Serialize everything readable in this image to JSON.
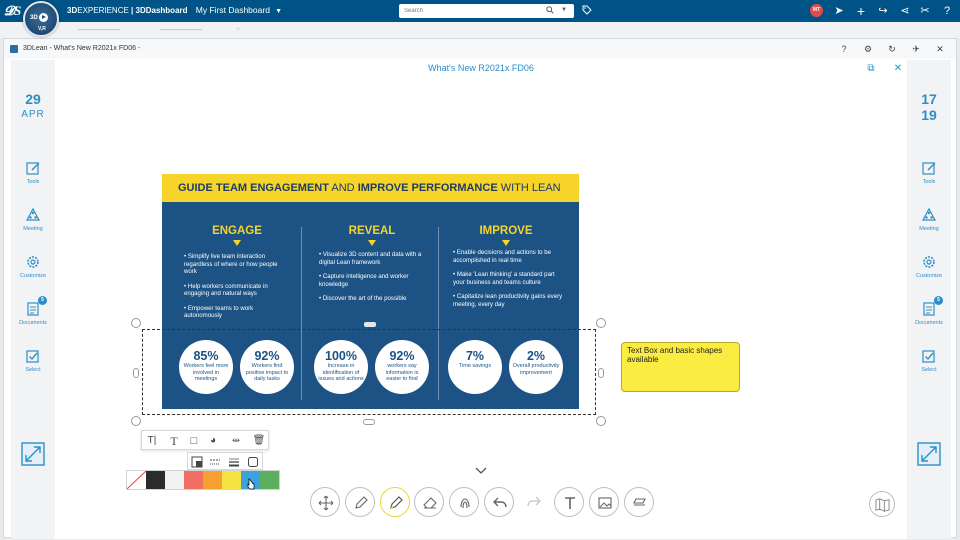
{
  "topbar": {
    "brand_3d": "3D",
    "brand_experience": "EXPERIENCE",
    "app_name": "| 3DDashboard",
    "dashboard_name": "My First Dashboard",
    "compass_3d": "3D",
    "compass_vr": "V,R",
    "search_placeholder": "Search",
    "user_initials": "MT",
    "icons": [
      "share-link-icon",
      "add-icon",
      "forward-icon",
      "share-icon",
      "settings-tools-icon",
      "help-icon"
    ]
  },
  "widget": {
    "title": "3DLean - What's New R2021x FD06 -",
    "header_buttons": [
      "help-icon",
      "settings-icon",
      "refresh-icon",
      "pin-icon",
      "close-icon"
    ],
    "doc_title": "What's New R2021x FD06"
  },
  "left_panel": {
    "date_day": "29",
    "date_month": "APR",
    "items": [
      {
        "label": "Tools",
        "icon": "tools-icon"
      },
      {
        "label": "Meeting",
        "icon": "meeting-icon"
      },
      {
        "label": "Customize",
        "icon": "customize-gear-icon"
      },
      {
        "label": "Documents",
        "icon": "documents-icon",
        "badge": "5"
      },
      {
        "label": "Select",
        "icon": "select-icon"
      }
    ]
  },
  "right_panel": {
    "date_top": "17",
    "date_bottom": "19",
    "items": [
      {
        "label": "Tools",
        "icon": "tools-icon"
      },
      {
        "label": "Meeting",
        "icon": "meeting-icon"
      },
      {
        "label": "Customize",
        "icon": "customize-gear-icon"
      },
      {
        "label": "Documents",
        "icon": "documents-icon",
        "badge": "5"
      },
      {
        "label": "Select",
        "icon": "select-icon"
      }
    ]
  },
  "slide": {
    "banner_part1": "GUIDE TEAM ENGAGEMENT",
    "banner_part2": "AND",
    "banner_part3": "IMPROVE PERFORMANCE",
    "banner_part4": "WITH LEAN",
    "columns": [
      {
        "heading": "ENGAGE",
        "bullets": [
          "• Simplify live team interaction regardless of where or how people work",
          "• Help workers communicate in engaging and natural ways",
          "• Empower teams to work autonomously"
        ],
        "stats": [
          {
            "value": "85%",
            "label": "Workers feel more involved in meetings"
          },
          {
            "value": "92%",
            "label": "Workers find positive impact to daily tasks"
          }
        ]
      },
      {
        "heading": "REVEAL",
        "bullets": [
          "• Visualize 3D content and data with a digital Lean framework",
          "• Capture intelligence and worker knowledge",
          "• Discover the art of the possible"
        ],
        "stats": [
          {
            "value": "100%",
            "label": "Increase in identification of issues and actions"
          },
          {
            "value": "92%",
            "label": "workers say information is easier to find"
          }
        ]
      },
      {
        "heading": "IMPROVE",
        "bullets": [
          "• Enable decisions and actions to be accomplished in real time",
          "• Make 'Lean thinking' a standard part your business and teams culture",
          "• Capitalize lean productivity gains every meeting, every day"
        ],
        "stats": [
          {
            "value": "7%",
            "label": "Time savings"
          },
          {
            "value": "2%",
            "label": "Overall productivity improvement"
          }
        ]
      }
    ]
  },
  "textbox": {
    "text": "Text Box and basic shapes available"
  },
  "format_toolbar": {
    "buttons": [
      "text-style-icon",
      "font-icon",
      "border-icon",
      "palette-icon",
      "fill-icon",
      "delete-icon"
    ],
    "sub_buttons": [
      "fill-color-icon",
      "dashed-line-icon",
      "line-weight-icon",
      "corner-shape-icon"
    ]
  },
  "colors": {
    "palette": [
      "none",
      "#2b2b2b",
      "#f1f1f1",
      "#f06e62",
      "#f6a032",
      "#f7e244",
      "#3aa3de",
      "#5daf5f"
    ],
    "slide_bg": "#1c5284",
    "banner_bg": "#f7d42a",
    "accent_blue": "#2b8fc7",
    "topbar_bg": "#005386"
  },
  "bottom_tools": [
    "move-icon",
    "pencil-icon",
    "highlighter-icon",
    "eraser-icon",
    "fingerprint-icon",
    "undo-icon",
    "redo-icon",
    "text-icon",
    "image-icon",
    "shape-icon"
  ],
  "map_button": "map-icon"
}
